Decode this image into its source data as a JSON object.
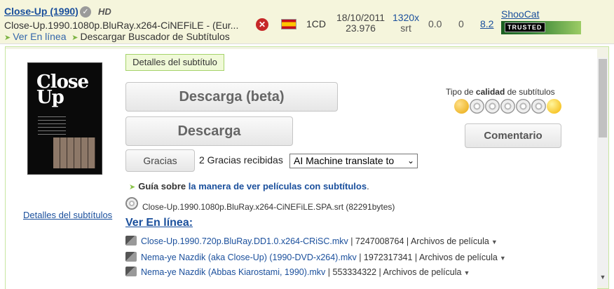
{
  "movie": {
    "title": "Close-Up (1990)",
    "hd": "HD",
    "release": "Close-Up.1990.1080p.BluRay.x264-CiNEFiLE - (Eur...",
    "view_online": "Ver En línea",
    "download_finder": "Descargar Buscador de Subtítulos",
    "cds": "1CD",
    "date": "18/10/2011",
    "fps": "23.976",
    "resolution": "1320x",
    "resolution_unit": "srt",
    "rating": "0.0",
    "votes": "0",
    "score": "8.2",
    "uploader": "ShooCat",
    "uploader_badge": "TRUSTED",
    "flag_color": "#c60b1e"
  },
  "detail": {
    "tab_label": "Detalles del subtítulo",
    "left_link": "Detalles del subtítulos",
    "poster_text": "Close Up",
    "download_beta": "Descarga (beta)",
    "download": "Descarga",
    "thanks_button": "Gracias",
    "thanks_count": "2 Gracias recibidas",
    "translate_select": "AI Machine translate to",
    "quality_prefix": "Tipo de ",
    "quality_bold": "calidad",
    "quality_suffix": " de subtítulos",
    "comment_button": "Comentario",
    "guide_prefix": "Guía sobre ",
    "guide_link": "la manera de ver películas con subtítulos",
    "guide_suffix": ".",
    "file_info": "Close-Up.1990.1080p.BluRay.x264-CiNEFiLE.SPA.srt (82291bytes)",
    "online_heading": "Ver En línea:",
    "online_items": [
      {
        "name": "Close-Up.1990.720p.BluRay.DD1.0.x264-CRiSC.mkv",
        "meta": " | 7247008764 | Archivos de película"
      },
      {
        "name": "Nema-ye Nazdik (aka Close-Up) (1990-DVD-x264).mkv",
        "meta": " | 1972317341 | Archivos de película"
      },
      {
        "name": "Nema-ye Nazdik (Abbas Kiarostami, 1990).mkv",
        "meta": " | 553334322 | Archivos de película"
      }
    ]
  },
  "colors": {
    "link": "#1a4f9c",
    "tab_border": "#a5d36a",
    "header_bg": "#f5f5dc"
  }
}
